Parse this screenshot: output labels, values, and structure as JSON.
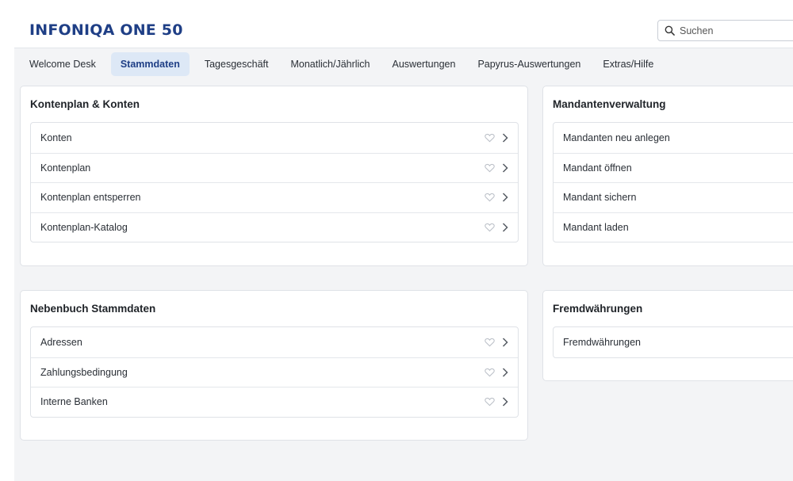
{
  "app": {
    "logo_text": "INFONIQA ONE 50",
    "brand_color": "#1f3f86"
  },
  "search": {
    "placeholder": "Suchen"
  },
  "tabs": [
    {
      "label": "Welcome Desk",
      "active": false
    },
    {
      "label": "Stammdaten",
      "active": true
    },
    {
      "label": "Tagesgeschäft",
      "active": false
    },
    {
      "label": "Monatlich/Jährlich",
      "active": false
    },
    {
      "label": "Auswertungen",
      "active": false
    },
    {
      "label": "Papyrus-Auswertungen",
      "active": false
    },
    {
      "label": "Extras/Hilfe",
      "active": false
    }
  ],
  "cards": {
    "kontenplan": {
      "title": "Kontenplan & Konten",
      "items": [
        "Konten",
        "Kontenplan",
        "Kontenplan entsperren",
        "Kontenplan-Katalog"
      ]
    },
    "mandanten": {
      "title": "Mandantenverwaltung",
      "items": [
        "Mandanten neu anlegen",
        "Mandant öffnen",
        "Mandant sichern",
        "Mandant laden"
      ]
    },
    "nebenbuch": {
      "title": "Nebenbuch Stammdaten",
      "items": [
        "Adressen",
        "Zahlungsbedingung",
        "Interne Banken"
      ]
    },
    "fremd": {
      "title": "Fremdwährungen",
      "items": [
        "Fremdwährungen"
      ]
    }
  },
  "icons": {
    "search": "search-icon",
    "favorite": "heart-outline-icon",
    "navigate": "chevron-right-icon"
  }
}
